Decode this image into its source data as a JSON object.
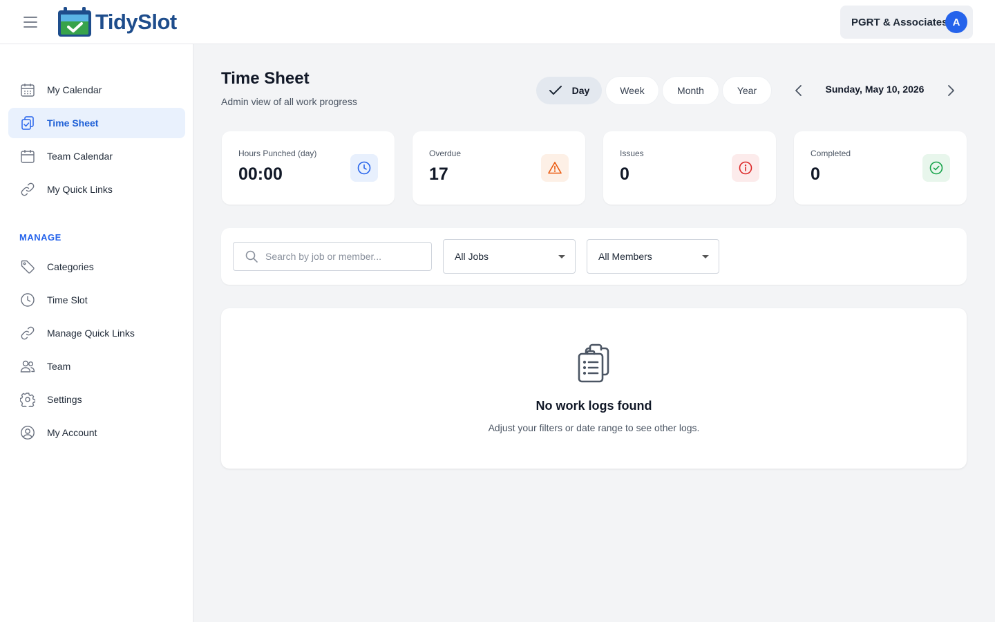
{
  "app": {
    "name": "TidySlot"
  },
  "header": {
    "org_name": "PGRT & Associates",
    "avatar_initial": "A"
  },
  "sidebar": {
    "items": [
      {
        "label": "My Calendar",
        "icon": "calendar-grid-icon",
        "active": false
      },
      {
        "label": "Time Sheet",
        "icon": "clipboard-check-icon",
        "active": true
      },
      {
        "label": "Team Calendar",
        "icon": "calendar-icon",
        "active": false
      },
      {
        "label": "My Quick Links",
        "icon": "link-icon",
        "active": false
      }
    ],
    "manage_label": "MANAGE",
    "manage_items": [
      {
        "label": "Categories",
        "icon": "tag-icon"
      },
      {
        "label": "Time Slot",
        "icon": "clock-icon"
      },
      {
        "label": "Manage Quick Links",
        "icon": "link-icon"
      },
      {
        "label": "Team",
        "icon": "users-icon"
      },
      {
        "label": "Settings",
        "icon": "gear-icon"
      },
      {
        "label": "My Account",
        "icon": "user-circle-icon"
      }
    ]
  },
  "page": {
    "title": "Time Sheet",
    "subtitle": "Admin view of all work progress"
  },
  "range_tabs": [
    {
      "label": "Day",
      "active": true
    },
    {
      "label": "Week",
      "active": false
    },
    {
      "label": "Month",
      "active": false
    },
    {
      "label": "Year",
      "active": false
    }
  ],
  "date_label": "Sunday, May 10, 2026",
  "stats": [
    {
      "label": "Hours Punched (day)",
      "value": "00:00",
      "icon": "clock-icon",
      "color": "#2563eb",
      "bg": "#e8f0fd"
    },
    {
      "label": "Overdue",
      "value": "17",
      "icon": "warning-icon",
      "color": "#ea580c",
      "bg": "#fdf0e6"
    },
    {
      "label": "Issues",
      "value": "0",
      "icon": "info-icon",
      "color": "#dc2626",
      "bg": "#fcebeb"
    },
    {
      "label": "Completed",
      "value": "0",
      "icon": "check-circle-icon",
      "color": "#16a34a",
      "bg": "#e8f6ec"
    }
  ],
  "filters": {
    "search_placeholder": "Search by job or member...",
    "jobs_select": "All Jobs",
    "members_select": "All Members"
  },
  "empty_state": {
    "title": "No work logs found",
    "subtitle": "Adjust your filters or date range to see other logs."
  }
}
